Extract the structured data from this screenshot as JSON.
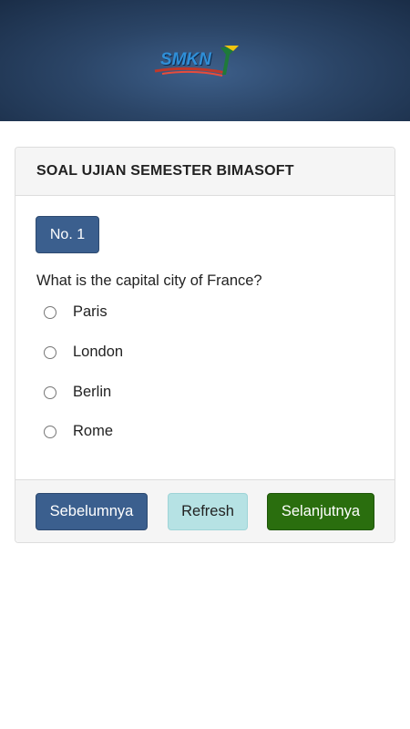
{
  "header": {
    "logo_text": "SMKN",
    "colors": {
      "background": "#2b4567"
    }
  },
  "card": {
    "title": "SOAL UJIAN SEMESTER BIMASOFT"
  },
  "question": {
    "number_label": "No. 1",
    "text": "What is the capital city of France?",
    "options": [
      "Paris",
      "London",
      "Berlin",
      "Rome"
    ],
    "selected": null
  },
  "footer": {
    "prev_label": "Sebelumnya",
    "refresh_label": "Refresh",
    "next_label": "Selanjutnya"
  },
  "colors": {
    "primary": "#3b5f8e",
    "info": "#b6e2e4",
    "success": "#2a6e0e"
  }
}
